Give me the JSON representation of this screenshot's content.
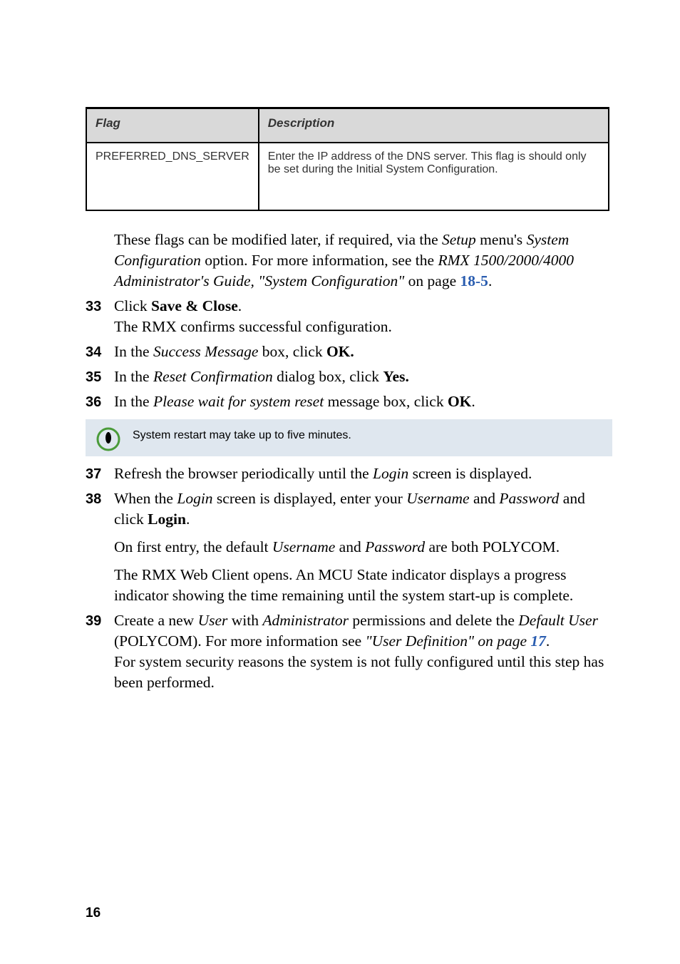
{
  "table": {
    "header": {
      "flag": "Flag",
      "desc": "Description"
    },
    "row": {
      "flag": "PREFERRED_DNS_SERVER",
      "desc": "Enter the IP address of the DNS server. This flag is should only be set during the Initial System Configuration."
    }
  },
  "intro": {
    "pre": "These flags can be modified later, if required, via the ",
    "setup": "Setup",
    "mid1": " menu's ",
    "sysconf": "System Configuration",
    "mid2": " option. For more information, see the ",
    "guide": "RMX 1500/2000/4000 Administrator's Guide, ",
    "systitle": "\"System Configuration\"",
    "onpage": " on page ",
    "pageref": "18-5",
    "dot": "."
  },
  "steps": {
    "s33": {
      "num": "33",
      "click": "Click ",
      "save": "Save & Close",
      "dot": ".",
      "confirm": "The RMX confirms successful configuration."
    },
    "s34": {
      "num": "34",
      "pre": "In the ",
      "smsg": "Success Message",
      "mid": " box, click ",
      "ok": "OK."
    },
    "s35": {
      "num": "35",
      "pre": "In the ",
      "rc": "Reset Confirmation",
      "mid": " dialog box, click ",
      "yes": "Yes."
    },
    "s36": {
      "num": "36",
      "pre": "In the ",
      "pw": "Please wait for system reset",
      "mid": " message box, click ",
      "ok": "OK",
      "dot": "."
    },
    "note": "System restart may take up to five minutes.",
    "s37": {
      "num": "37",
      "pre": "Refresh the browser periodically until the ",
      "login": "Login",
      "post": " screen is displayed."
    },
    "s38": {
      "num": "38",
      "pre": "When the ",
      "login": "Login",
      "mid1": " screen is displayed, enter your ",
      "uname": "Username",
      "and": " and ",
      "pwd": "Password",
      "andclick": " and click ",
      "loginb": "Login",
      "dot": ".",
      "p2pre": "On first entry, the default ",
      "p2uname": "Username",
      "p2and": " and ",
      "p2pwd": "Password",
      "p2both": " are both ",
      "polycom": "POLYCOM",
      "p2dot": ".",
      "p3": "The RMX Web Client opens. An MCU State indicator displays a progress indicator showing the time remaining until the system start-up is complete."
    },
    "s39": {
      "num": "39",
      "pre": "Create a new ",
      "user": "User",
      "with": " with ",
      "admin": "Administrator",
      "perm": " permissions and delete the ",
      "defuser": "Default User",
      "paren1": " (",
      "polycom": "POLYCOM",
      "paren2": "). For more information see ",
      "quote": "\"",
      "ud": "User Definition\" on page ",
      "pageref": "17",
      "dot": ".",
      "p2": "For system security reasons the system is not fully configured until this step has been performed."
    }
  },
  "pagenum": "16"
}
